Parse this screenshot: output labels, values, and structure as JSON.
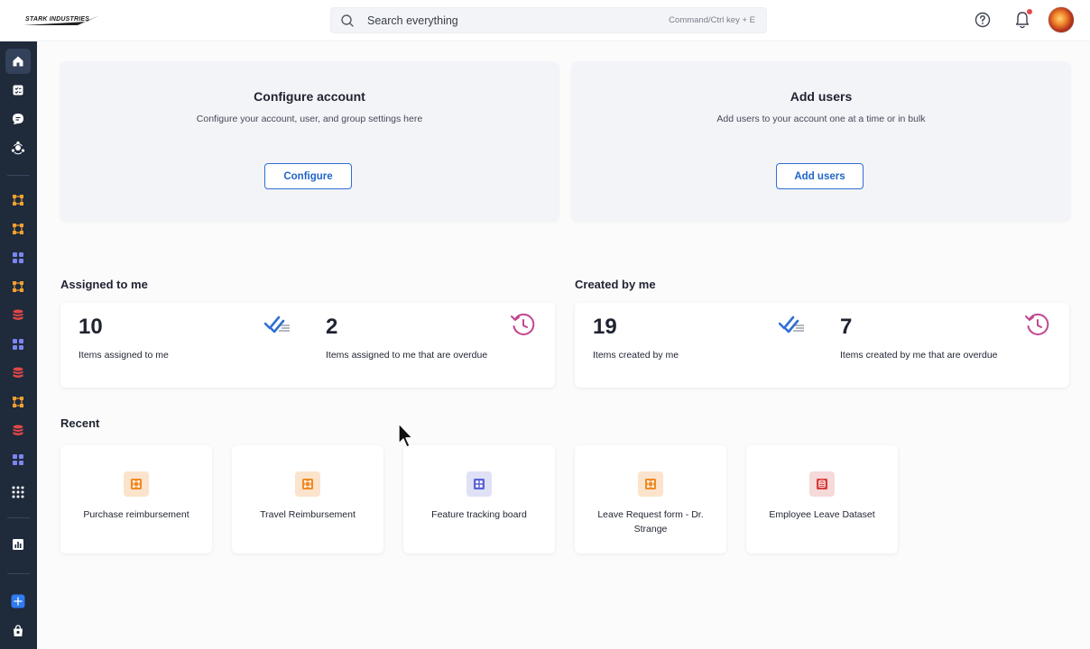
{
  "header": {
    "logo_text": "STARK INDUSTRIES",
    "search_placeholder": "Search everything",
    "search_hint": "Command/Ctrl key + E"
  },
  "config_cards": [
    {
      "title": "Configure account",
      "description": "Configure your account, user, and group settings here",
      "button": "Configure"
    },
    {
      "title": "Add users",
      "description": "Add users to your account one at a time or in bulk",
      "button": "Add users"
    }
  ],
  "assigned": {
    "title": "Assigned to me",
    "stats": [
      {
        "value": "10",
        "label": "Items assigned to me"
      },
      {
        "value": "2",
        "label": "Items assigned to me that are overdue"
      }
    ]
  },
  "created": {
    "title": "Created by me",
    "stats": [
      {
        "value": "19",
        "label": "Items created by me"
      },
      {
        "value": "7",
        "label": "Items created by me that are overdue"
      }
    ]
  },
  "recent": {
    "title": "Recent",
    "items": [
      {
        "label": "Purchase reimbursement",
        "icon": "workflow-icon",
        "color": "#f08a24"
      },
      {
        "label": "Travel Reimbursement",
        "icon": "workflow-icon",
        "color": "#f08a24"
      },
      {
        "label": "Feature tracking board",
        "icon": "board-icon",
        "color": "#5b63d3"
      },
      {
        "label": "Leave Request form - Dr. Strange",
        "icon": "workflow-icon",
        "color": "#f08a24"
      },
      {
        "label": "Employee Leave Dataset",
        "icon": "dataset-icon",
        "color": "#d83a3a"
      }
    ]
  },
  "colors": {
    "accent": "#2265c9",
    "sidebar_bg": "#1f2a3b",
    "workflow": "#f08a24",
    "board": "#5b63d3",
    "dataset": "#d83a3a",
    "overdue": "#c2468f"
  }
}
